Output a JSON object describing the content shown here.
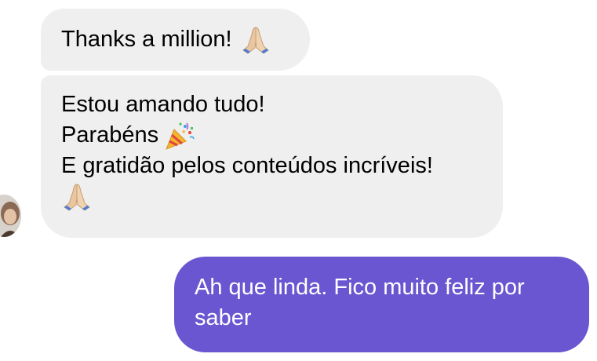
{
  "conversation": {
    "messages": [
      {
        "sender": "other",
        "lines": [
          {
            "text": "Thanks a million!",
            "emoji": "folded-hands-icon"
          }
        ]
      },
      {
        "sender": "other",
        "lines": [
          {
            "text": "Estou amando tudo!"
          },
          {
            "text": "Parabéns",
            "emoji": "party-popper-icon"
          },
          {
            "text": "E gratidão pelos conteúdos incríveis!"
          },
          {
            "text": "",
            "emoji": "folded-hands-icon"
          }
        ]
      },
      {
        "sender": "me",
        "text": "Ah que linda. Fico muito feliz por saber"
      }
    ]
  },
  "colors": {
    "incoming_bubble": "#efefef",
    "outgoing_bubble": "#6a56d1",
    "outgoing_text": "#ffffff"
  }
}
